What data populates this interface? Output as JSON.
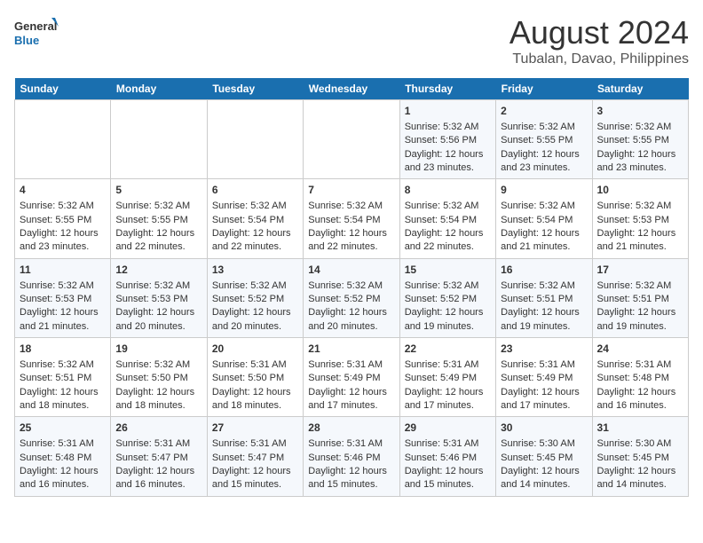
{
  "header": {
    "logo_line1": "General",
    "logo_line2": "Blue",
    "title": "August 2024",
    "subtitle": "Tubalan, Davao, Philippines"
  },
  "days_of_week": [
    "Sunday",
    "Monday",
    "Tuesday",
    "Wednesday",
    "Thursday",
    "Friday",
    "Saturday"
  ],
  "weeks": [
    [
      {
        "day": "",
        "info": ""
      },
      {
        "day": "",
        "info": ""
      },
      {
        "day": "",
        "info": ""
      },
      {
        "day": "",
        "info": ""
      },
      {
        "day": "1",
        "info": "Sunrise: 5:32 AM\nSunset: 5:56 PM\nDaylight: 12 hours\nand 23 minutes."
      },
      {
        "day": "2",
        "info": "Sunrise: 5:32 AM\nSunset: 5:55 PM\nDaylight: 12 hours\nand 23 minutes."
      },
      {
        "day": "3",
        "info": "Sunrise: 5:32 AM\nSunset: 5:55 PM\nDaylight: 12 hours\nand 23 minutes."
      }
    ],
    [
      {
        "day": "4",
        "info": "Sunrise: 5:32 AM\nSunset: 5:55 PM\nDaylight: 12 hours\nand 23 minutes."
      },
      {
        "day": "5",
        "info": "Sunrise: 5:32 AM\nSunset: 5:55 PM\nDaylight: 12 hours\nand 22 minutes."
      },
      {
        "day": "6",
        "info": "Sunrise: 5:32 AM\nSunset: 5:54 PM\nDaylight: 12 hours\nand 22 minutes."
      },
      {
        "day": "7",
        "info": "Sunrise: 5:32 AM\nSunset: 5:54 PM\nDaylight: 12 hours\nand 22 minutes."
      },
      {
        "day": "8",
        "info": "Sunrise: 5:32 AM\nSunset: 5:54 PM\nDaylight: 12 hours\nand 22 minutes."
      },
      {
        "day": "9",
        "info": "Sunrise: 5:32 AM\nSunset: 5:54 PM\nDaylight: 12 hours\nand 21 minutes."
      },
      {
        "day": "10",
        "info": "Sunrise: 5:32 AM\nSunset: 5:53 PM\nDaylight: 12 hours\nand 21 minutes."
      }
    ],
    [
      {
        "day": "11",
        "info": "Sunrise: 5:32 AM\nSunset: 5:53 PM\nDaylight: 12 hours\nand 21 minutes."
      },
      {
        "day": "12",
        "info": "Sunrise: 5:32 AM\nSunset: 5:53 PM\nDaylight: 12 hours\nand 20 minutes."
      },
      {
        "day": "13",
        "info": "Sunrise: 5:32 AM\nSunset: 5:52 PM\nDaylight: 12 hours\nand 20 minutes."
      },
      {
        "day": "14",
        "info": "Sunrise: 5:32 AM\nSunset: 5:52 PM\nDaylight: 12 hours\nand 20 minutes."
      },
      {
        "day": "15",
        "info": "Sunrise: 5:32 AM\nSunset: 5:52 PM\nDaylight: 12 hours\nand 19 minutes."
      },
      {
        "day": "16",
        "info": "Sunrise: 5:32 AM\nSunset: 5:51 PM\nDaylight: 12 hours\nand 19 minutes."
      },
      {
        "day": "17",
        "info": "Sunrise: 5:32 AM\nSunset: 5:51 PM\nDaylight: 12 hours\nand 19 minutes."
      }
    ],
    [
      {
        "day": "18",
        "info": "Sunrise: 5:32 AM\nSunset: 5:51 PM\nDaylight: 12 hours\nand 18 minutes."
      },
      {
        "day": "19",
        "info": "Sunrise: 5:32 AM\nSunset: 5:50 PM\nDaylight: 12 hours\nand 18 minutes."
      },
      {
        "day": "20",
        "info": "Sunrise: 5:31 AM\nSunset: 5:50 PM\nDaylight: 12 hours\nand 18 minutes."
      },
      {
        "day": "21",
        "info": "Sunrise: 5:31 AM\nSunset: 5:49 PM\nDaylight: 12 hours\nand 17 minutes."
      },
      {
        "day": "22",
        "info": "Sunrise: 5:31 AM\nSunset: 5:49 PM\nDaylight: 12 hours\nand 17 minutes."
      },
      {
        "day": "23",
        "info": "Sunrise: 5:31 AM\nSunset: 5:49 PM\nDaylight: 12 hours\nand 17 minutes."
      },
      {
        "day": "24",
        "info": "Sunrise: 5:31 AM\nSunset: 5:48 PM\nDaylight: 12 hours\nand 16 minutes."
      }
    ],
    [
      {
        "day": "25",
        "info": "Sunrise: 5:31 AM\nSunset: 5:48 PM\nDaylight: 12 hours\nand 16 minutes."
      },
      {
        "day": "26",
        "info": "Sunrise: 5:31 AM\nSunset: 5:47 PM\nDaylight: 12 hours\nand 16 minutes."
      },
      {
        "day": "27",
        "info": "Sunrise: 5:31 AM\nSunset: 5:47 PM\nDaylight: 12 hours\nand 15 minutes."
      },
      {
        "day": "28",
        "info": "Sunrise: 5:31 AM\nSunset: 5:46 PM\nDaylight: 12 hours\nand 15 minutes."
      },
      {
        "day": "29",
        "info": "Sunrise: 5:31 AM\nSunset: 5:46 PM\nDaylight: 12 hours\nand 15 minutes."
      },
      {
        "day": "30",
        "info": "Sunrise: 5:30 AM\nSunset: 5:45 PM\nDaylight: 12 hours\nand 14 minutes."
      },
      {
        "day": "31",
        "info": "Sunrise: 5:30 AM\nSunset: 5:45 PM\nDaylight: 12 hours\nand 14 minutes."
      }
    ]
  ]
}
